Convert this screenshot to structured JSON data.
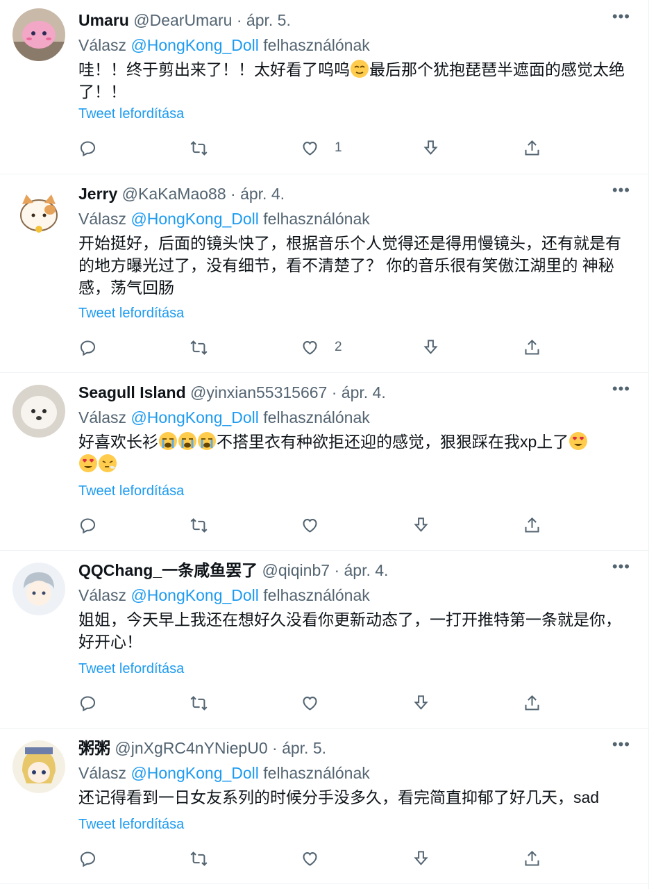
{
  "common": {
    "reply_prefix": "Válasz",
    "reply_target": "@HongKong_Doll",
    "reply_suffix": "felhasználónak",
    "translate_label": "Tweet lefordítása",
    "more_label": "•••",
    "dot": "·"
  },
  "tweets": [
    {
      "name": "Umaru",
      "handle": "@DearUmaru",
      "date": "ápr. 5.",
      "text_a": "哇！！终于剪出来了！！太好看了呜呜",
      "emoji_1": "relieved-face",
      "text_b": "最后那个犹抱琵琶半遮面的感觉太绝了！！",
      "like_count": "1"
    },
    {
      "name": "Jerry",
      "handle": "@KaKaMao88",
      "date": "ápr. 4.",
      "text": "开始挺好，后面的镜头快了，根据音乐个人觉得还是得用慢镜头，还有就是有的地方曝光过了，没有细节，看不清楚了？ 你的音乐很有笑傲江湖里的 神秘感，荡气回肠",
      "like_count": "2"
    },
    {
      "name": "Seagull Island",
      "handle": "@yinxian55315667",
      "date": "ápr. 4.",
      "text_a": "好喜欢长衫",
      "emoji_1": "crying-face",
      "text_b": "不搭里衣有种欲拒还迎的感觉，狠狠踩在我xp上了",
      "emoji_2": "heart-eyes-face",
      "emoji_3": "steam-face",
      "like_count": ""
    },
    {
      "name": "QQChang_一条咸鱼罢了",
      "handle": "@qiqinb7",
      "date": "ápr. 4.",
      "text": "姐姐，今天早上我还在想好久没看你更新动态了，一打开推特第一条就是你，好开心！",
      "like_count": ""
    },
    {
      "name": "粥粥",
      "handle": "@jnXgRC4nYNiepU0",
      "date": "ápr. 5.",
      "text": "还记得看到一日女友系列的时候分手没多久，看完简直抑郁了好几天，sad",
      "like_count": ""
    }
  ],
  "icons": [
    "reply-icon",
    "retweet-icon",
    "like-icon",
    "download-icon",
    "share-icon"
  ],
  "colors": {
    "link": "#1d9bf0",
    "secondary": "#536471",
    "text": "#0f1419",
    "divider": "#eff3f4"
  }
}
